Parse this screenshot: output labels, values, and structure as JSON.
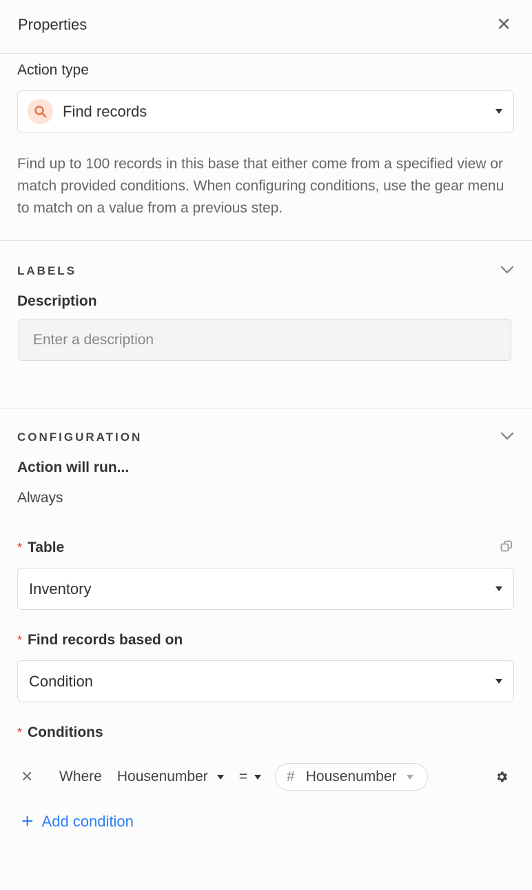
{
  "header": {
    "title": "Properties",
    "close_glyph": "✕",
    "close_icon": "close-icon"
  },
  "action": {
    "label": "Action type",
    "selected": "Find records",
    "icon": "search-icon",
    "icon_color": "#e8734a",
    "icon_bg": "#fde3d8",
    "description": "Find up to 100 records in this base that either come from a specified view or match provided conditions. When configuring conditions, use the gear menu to match on a value from a previous step."
  },
  "labels_section": {
    "heading": "LABELS",
    "description_label": "Description",
    "description_placeholder": "Enter a description",
    "description_value": ""
  },
  "config_section": {
    "heading": "CONFIGURATION",
    "run_label": "Action will run...",
    "run_value": "Always",
    "table": {
      "label": "Table",
      "required_mark": "*",
      "value": "Inventory",
      "corner_icon": "copy-icon"
    },
    "find_based_on": {
      "label": "Find records based on",
      "required_mark": "*",
      "value": "Condition"
    },
    "conditions": {
      "label": "Conditions",
      "required_mark": "*",
      "rows": [
        {
          "remove_glyph": "✕",
          "where": "Where",
          "field": "Housenumber",
          "operator": "=",
          "value_type_glyph": "#",
          "value": "Housenumber",
          "gear_icon": "gear-icon"
        }
      ],
      "add_label": "Add condition",
      "add_glyph": "+"
    }
  },
  "colors": {
    "accent_blue": "#2d7ff9",
    "required_red": "#e03a3a",
    "border": "#e2e2e2"
  }
}
